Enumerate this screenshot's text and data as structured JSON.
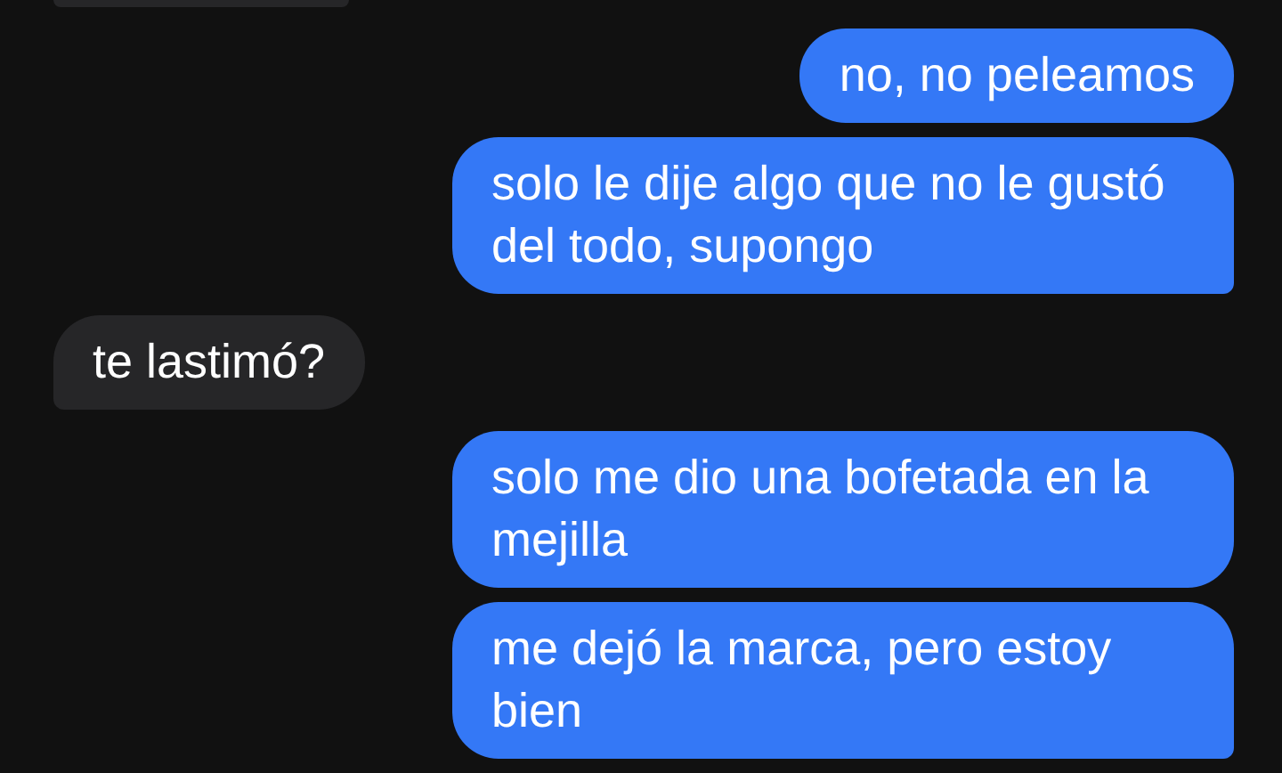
{
  "messages": [
    {
      "kind": "received",
      "tail": false
    },
    {
      "kind": "sent",
      "text": "no, no peleamos",
      "tail": false
    },
    {
      "kind": "sent",
      "text": "solo le dije algo que no le gustó del todo, supongo",
      "tail": true
    },
    {
      "kind": "received",
      "text": "te lastimó?",
      "tail": true
    },
    {
      "kind": "sent",
      "text": "solo me dio una bofetada en la mejilla",
      "tail": false
    },
    {
      "kind": "sent",
      "text": "me dejó la marca, pero estoy bien",
      "tail": true
    }
  ]
}
